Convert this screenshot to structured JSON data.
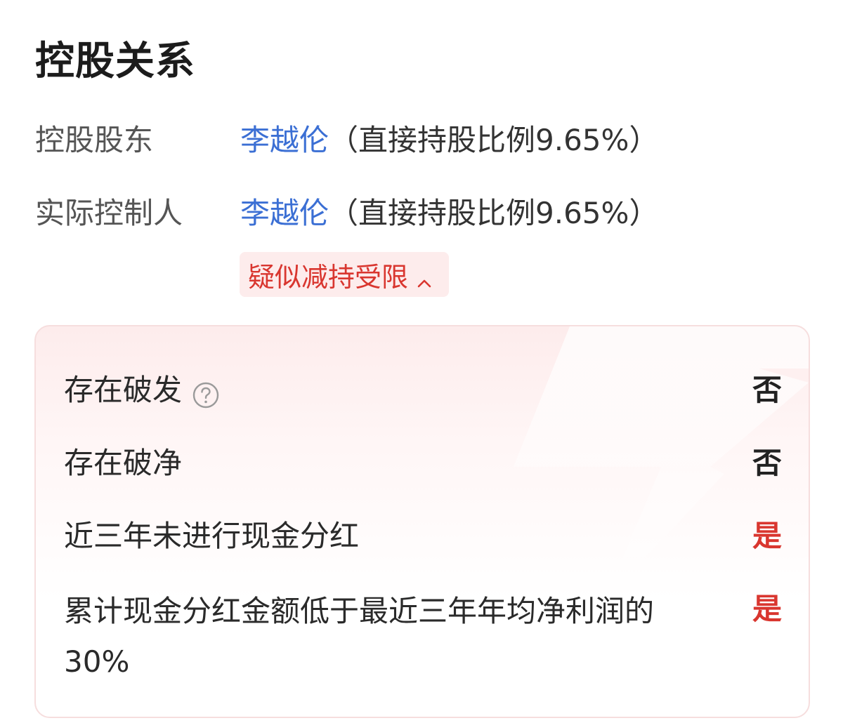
{
  "section": {
    "title": "控股关系"
  },
  "controlling_shareholder": {
    "label": "控股股东",
    "name": "李越伦",
    "note": "（直接持股比例9.65%）"
  },
  "actual_controller": {
    "label": "实际控制人",
    "name": "李越伦",
    "note": "（直接持股比例9.65%）"
  },
  "risk_tag": {
    "label": "疑似减持受限",
    "icon": "chevron-up-icon",
    "color": "#d9362f"
  },
  "risk_items": [
    {
      "label": "存在破发",
      "value": "否",
      "has_help": true
    },
    {
      "label": "存在破净",
      "value": "否",
      "has_help": false
    },
    {
      "label": "近三年未进行现金分红",
      "value": "是",
      "has_help": false
    },
    {
      "label": "累计现金分红金额低于最近三年年均净利润的30%",
      "value": "是",
      "has_help": false
    }
  ],
  "colors": {
    "link": "#3b6fd4",
    "alert": "#d9362f",
    "panel_border": "#f6dede"
  }
}
